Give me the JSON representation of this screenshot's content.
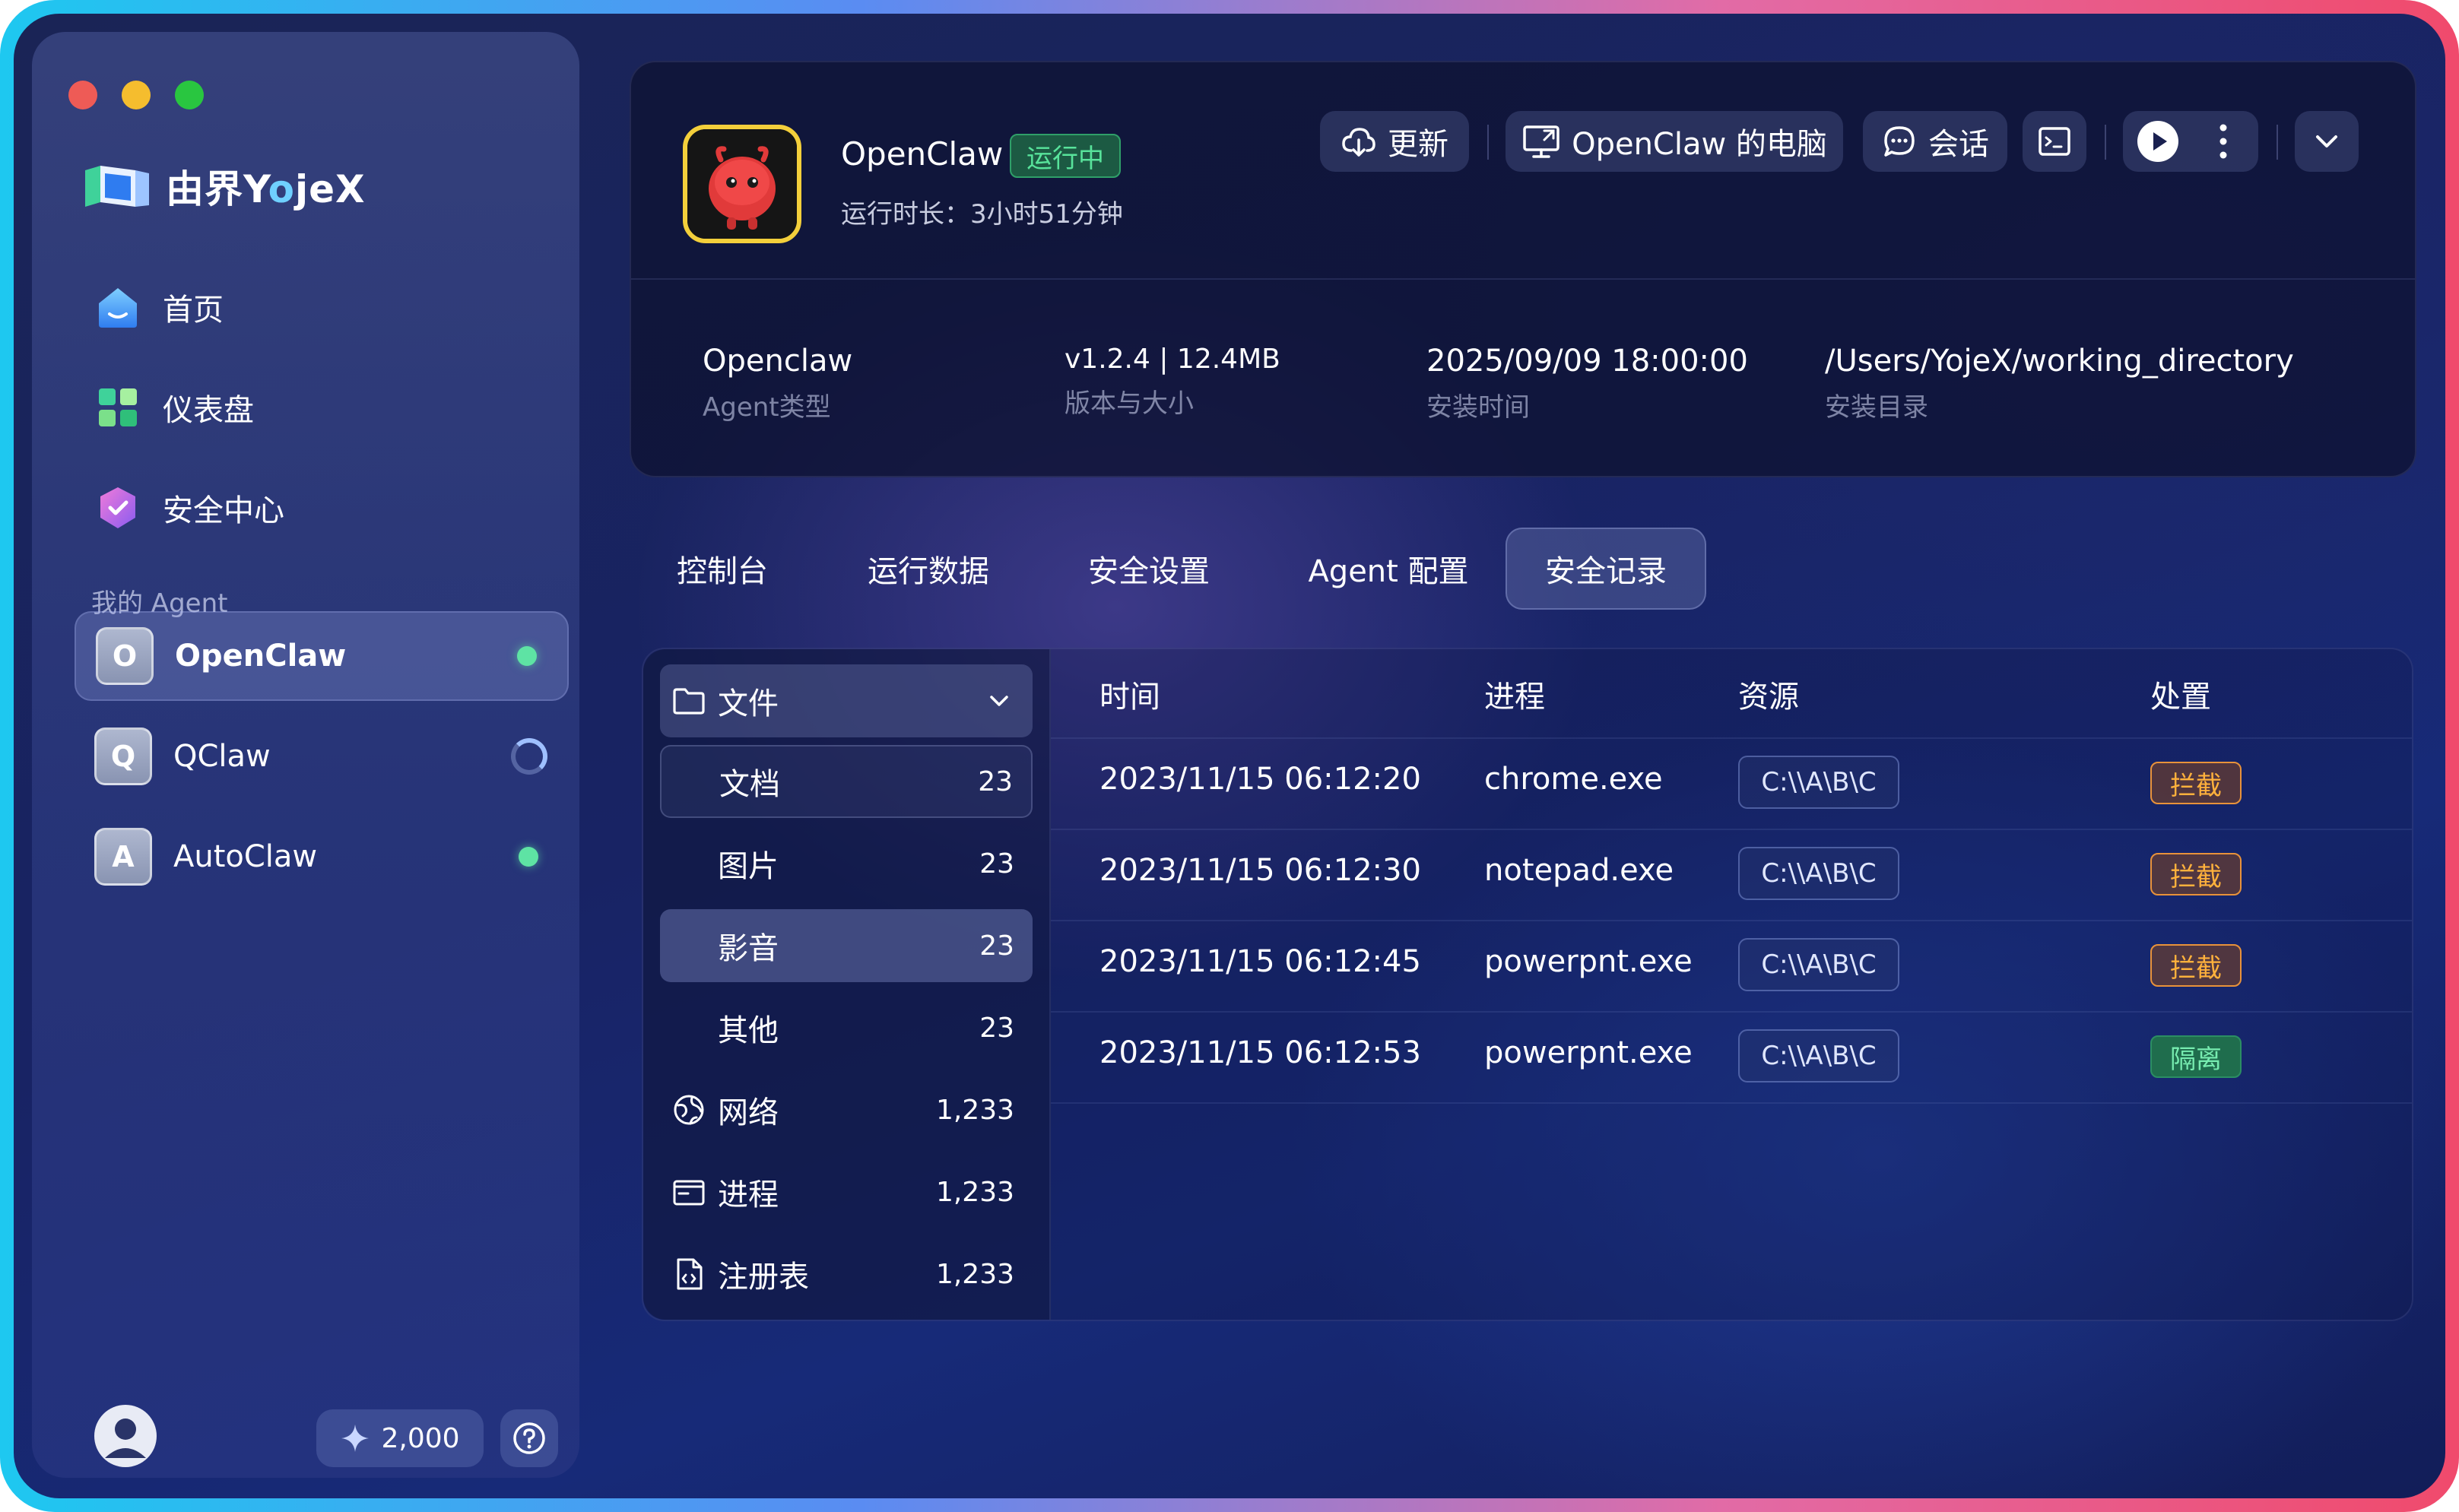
{
  "window": {
    "controls": [
      "close",
      "minimize",
      "zoom"
    ],
    "accent_colors": {
      "running": "#58e39b",
      "block": "#ffb13c",
      "quarantine": "#77ecb0"
    }
  },
  "sidebar": {
    "brand": {
      "prefix": "由界Y",
      "o": "o",
      "suffix": "jeX"
    },
    "nav": [
      {
        "label": "首页",
        "icon": "home-icon"
      },
      {
        "label": "仪表盘",
        "icon": "dashboard-icon"
      },
      {
        "label": "安全中心",
        "icon": "security-icon"
      }
    ],
    "section_label": "我的 Agent",
    "agents": [
      {
        "initial": "O",
        "name": "OpenClaw",
        "status": "running",
        "active": true
      },
      {
        "initial": "Q",
        "name": "QClaw",
        "status": "loading",
        "active": false
      },
      {
        "initial": "A",
        "name": "AutoClaw",
        "status": "running",
        "active": false
      }
    ],
    "credits": "2,000"
  },
  "header": {
    "app_name": "OpenClaw",
    "status_badge": "运行中",
    "uptime": "运行时长：3小时51分钟",
    "buttons": {
      "update": "更新",
      "computer": "OpenClaw 的电脑",
      "chat": "会话"
    },
    "meta": [
      {
        "value": "Openclaw",
        "label": "Agent类型"
      },
      {
        "value": "v1.2.4 | 12.4MB",
        "label": "版本与大小"
      },
      {
        "value": "2025/09/09 18:00:00",
        "label": "安装时间"
      },
      {
        "value": "/Users/YojeX/working_directory",
        "label": "安装目录"
      }
    ]
  },
  "tabs": [
    "控制台",
    "运行数据",
    "安全设置",
    "Agent 配置",
    "安全记录"
  ],
  "active_tab": "安全记录",
  "categories": {
    "file": {
      "label": "文件",
      "expanded": true
    },
    "file_children": [
      {
        "label": "文档",
        "count": "23"
      },
      {
        "label": "图片",
        "count": "23"
      },
      {
        "label": "影音",
        "count": "23"
      },
      {
        "label": "其他",
        "count": "23"
      }
    ],
    "others": [
      {
        "label": "网络",
        "count": "1,233",
        "icon": "network-icon"
      },
      {
        "label": "进程",
        "count": "1,233",
        "icon": "process-icon"
      },
      {
        "label": "注册表",
        "count": "1,233",
        "icon": "registry-icon"
      }
    ]
  },
  "table": {
    "headers": [
      "时间",
      "进程",
      "资源",
      "处置"
    ],
    "rows": [
      {
        "time": "2023/11/15 06:12:20",
        "process": "chrome.exe",
        "resource": "C:\\\\A\\B\\C",
        "action": "拦截"
      },
      {
        "time": "2023/11/15 06:12:30",
        "process": "notepad.exe",
        "resource": "C:\\\\A\\B\\C",
        "action": "拦截"
      },
      {
        "time": "2023/11/15 06:12:45",
        "process": "powerpnt.exe",
        "resource": "C:\\\\A\\B\\C",
        "action": "拦截"
      },
      {
        "time": "2023/11/15 06:12:53",
        "process": "powerpnt.exe",
        "resource": "C:\\\\A\\B\\C",
        "action": "隔离"
      }
    ]
  }
}
